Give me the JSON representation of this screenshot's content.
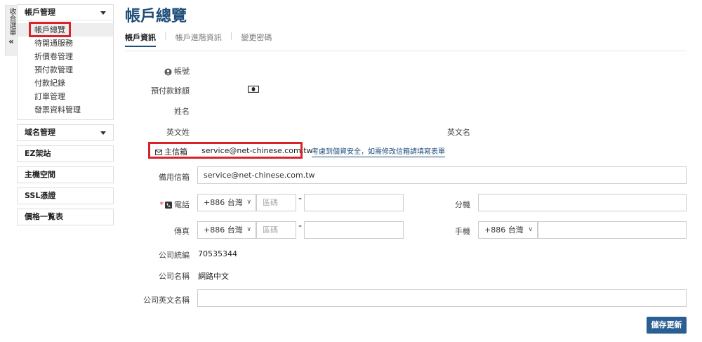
{
  "collapse": {
    "label": "收合選單",
    "chevron": "«"
  },
  "sidebar": {
    "account_header": "帳戶管理",
    "account_items": [
      "帳戶總覽",
      "待開通服務",
      "折價卷管理",
      "預付款管理",
      "付款紀錄",
      "訂單管理",
      "發票資料管理"
    ],
    "domain_header": "域名管理",
    "ez_site": "EZ架站",
    "hosting": "主機空間",
    "ssl": "SSL憑證",
    "price_list": "價格一覧表"
  },
  "main": {
    "title": "帳戶總覽",
    "tabs": [
      "帳戶資訊",
      "帳戶進階資訊",
      "變更密碼"
    ]
  },
  "form": {
    "account_label": "帳號",
    "prepaid_label": "預付款餘額",
    "name_label": "姓名",
    "en_last_label": "英文姓",
    "en_first_label": "英文名",
    "primary_email_label": "主信箱",
    "primary_email_value": "service@net-chinese.com.tw",
    "email_note": "考慮到個資安全，如需修改信箱請填寫表單",
    "backup_email_label": "備用信箱",
    "backup_email_value": "service@net-chinese.com.tw",
    "phone_label": "電話",
    "phone_country": "+886 台灣",
    "area_placeholder": "區碼",
    "dash": "-",
    "ext_label": "分機",
    "fax_label": "傳真",
    "fax_country": "+886 台灣",
    "mobile_label": "手機",
    "mobile_country": "+886 台灣",
    "tax_id_label": "公司統編",
    "tax_id_value": "70535344",
    "company_label": "公司名稱",
    "company_value": "網路中文",
    "company_en_label": "公司英文名稱",
    "save_label": "儲存更新",
    "required_mark": "*"
  },
  "icons": {
    "user": "user-circle-icon",
    "money": "money-icon",
    "mail": "mail-icon",
    "phone": "phone-icon",
    "caret": "caret-down-icon"
  },
  "colors": {
    "accent": "#1f4e79",
    "highlight": "#d9232a",
    "button": "#2a5f93"
  }
}
